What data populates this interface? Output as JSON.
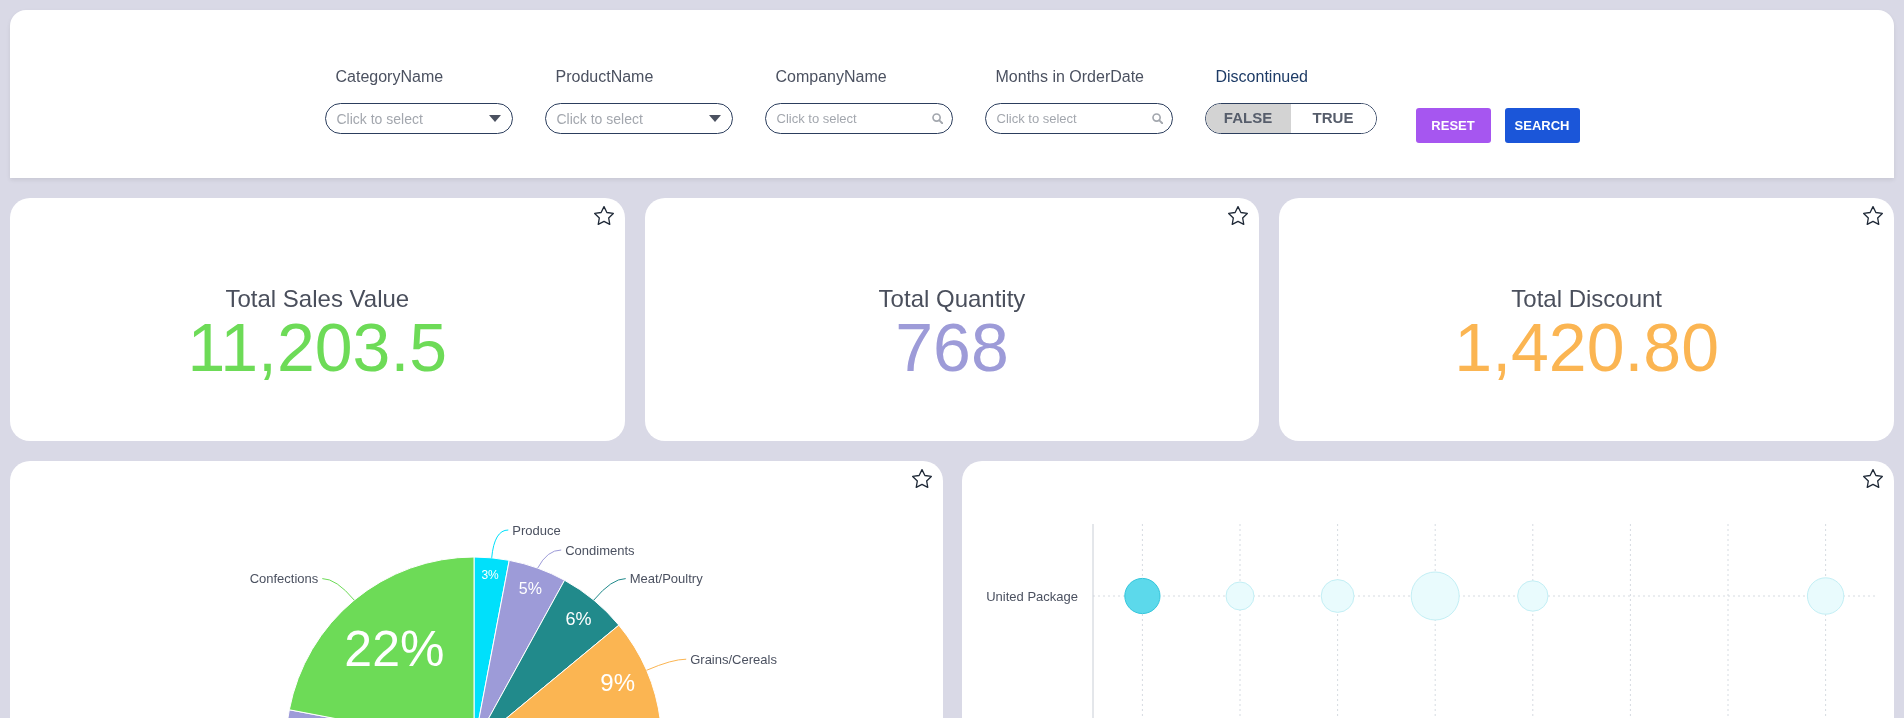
{
  "filters": [
    {
      "kind": "dropdown",
      "label": "CategoryName",
      "placeholder": "Click to select"
    },
    {
      "kind": "dropdown",
      "label": "ProductName",
      "placeholder": "Click to select"
    },
    {
      "kind": "search",
      "label": "CompanyName",
      "placeholder": "Click to select"
    },
    {
      "kind": "search",
      "label": "Months in OrderDate",
      "placeholder": "Click to select"
    },
    {
      "kind": "toggle",
      "label": "Discontinued",
      "options": [
        {
          "label": "FALSE",
          "selected": true
        },
        {
          "label": "TRUE",
          "selected": false
        }
      ]
    }
  ],
  "buttons": [
    {
      "kind": "reset",
      "label": "RESET"
    },
    {
      "kind": "submit",
      "label": "SEARCH"
    }
  ],
  "kpis": [
    {
      "title": "Total Sales Value",
      "value": "11,203.5",
      "color": "#6ddb57"
    },
    {
      "title": "Total Quantity",
      "value": "768",
      "color": "#9d9bd8"
    },
    {
      "title": "Total Discount",
      "value": "1,420.80",
      "color": "#fbb552"
    }
  ],
  "category_chart": {
    "chart_data": {
      "type": "pie",
      "categories": [
        "Produce",
        "Condiments",
        "Meat/Poultry",
        "Grains/Cereals",
        null,
        "Confections"
      ],
      "values": [
        3,
        5,
        6,
        9,
        55,
        22
      ],
      "colors": [
        "#00e0fb",
        "#9d9bd8",
        "#218a8b",
        "#fbb552",
        "#9d9bd8",
        "#6ddb57"
      ],
      "value_labels": [
        "3%",
        "5%",
        "6%",
        "9%",
        null,
        "22%"
      ]
    }
  },
  "bubble_chart": {
    "y_categories": [
      "United Package"
    ],
    "bubbles": [
      {
        "selected": true
      },
      {
        "selected": false
      },
      {
        "selected": false
      },
      {
        "selected": false
      },
      {
        "selected": false
      },
      {
        "selected": false
      }
    ]
  }
}
